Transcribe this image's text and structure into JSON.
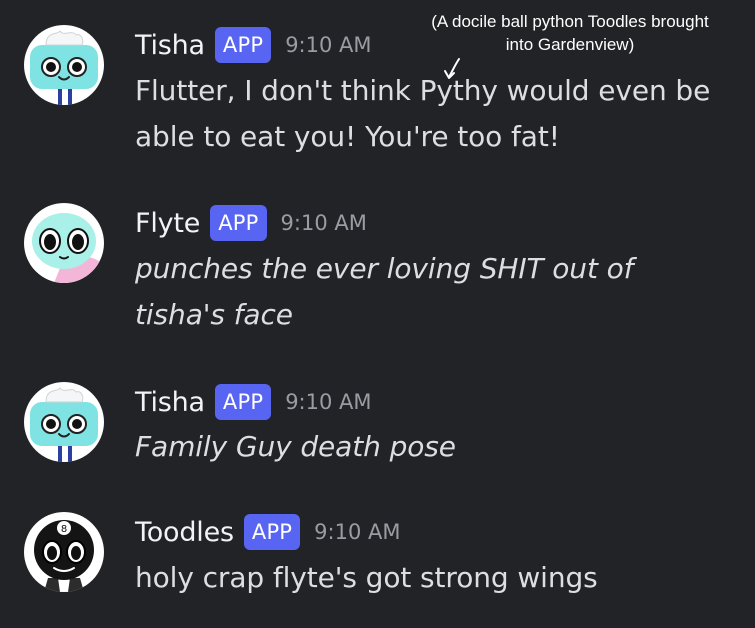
{
  "messages": [
    {
      "username": "Tisha",
      "badge": "APP",
      "timestamp": "9:10 AM",
      "content": "Flutter, I don't think Pythy would even be able to eat you! You're too fat!",
      "avatar": "tisha-avatar"
    },
    {
      "username": "Flyte",
      "badge": "APP",
      "timestamp": "9:10 AM",
      "content": "punches the ever loving SHIT out of tisha's face",
      "avatar": "flyte-avatar"
    },
    {
      "username": "Tisha",
      "badge": "APP",
      "timestamp": "9:10 AM",
      "content": "Family Guy death pose",
      "avatar": "tisha-avatar"
    },
    {
      "username": "Toodles",
      "badge": "APP",
      "timestamp": "9:10 AM",
      "content": "holy crap flyte's got strong wings",
      "avatar": "toodles-avatar"
    }
  ],
  "annotation": {
    "text": "(A docile ball python Toodles brought into Gardenview)"
  },
  "colors": {
    "background": "#222327",
    "badge": "#5865f2",
    "username": "#f2f3f5",
    "message_text": "#dcdee1",
    "timestamp": "#9a9ca3"
  }
}
